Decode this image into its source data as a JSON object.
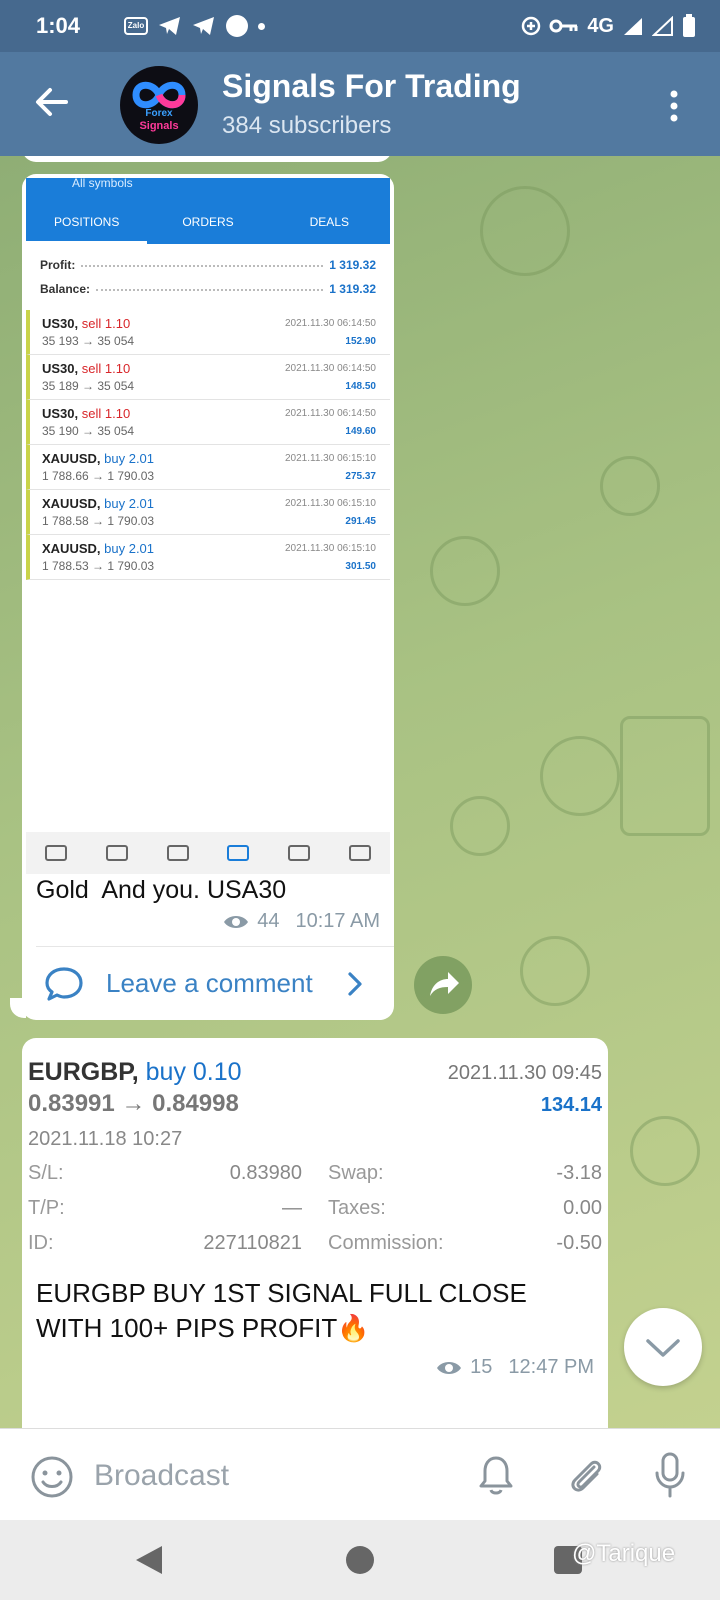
{
  "status": {
    "time": "1:04",
    "zalo": "Zalo",
    "network": "4G"
  },
  "header": {
    "back_icon": "arrow-left-icon",
    "avatar_line1": "Forex",
    "avatar_line2": "Signals",
    "title": "Signals For Trading",
    "subtitle": "384 subscribers"
  },
  "post1": {
    "screenshot": {
      "symbols_label": "All symbols",
      "tabs": [
        "POSITIONS",
        "ORDERS",
        "DEALS"
      ],
      "profit_label": "Profit:",
      "profit_value": "1 319.32",
      "balance_label": "Balance:",
      "balance_value": "1 319.32",
      "trades": [
        {
          "symbol": "US30,",
          "side": "sell 1.10",
          "prices": "35 193 → 35 054",
          "time": "2021.11.30 06:14:50",
          "profit": "152.90"
        },
        {
          "symbol": "US30,",
          "side": "sell 1.10",
          "prices": "35 189 → 35 054",
          "time": "2021.11.30 06:14:50",
          "profit": "148.50"
        },
        {
          "symbol": "US30,",
          "side": "sell 1.10",
          "prices": "35 190 → 35 054",
          "time": "2021.11.30 06:14:50",
          "profit": "149.60"
        },
        {
          "symbol": "XAUUSD,",
          "side": "buy 2.01",
          "prices": "1 788.66 → 1 790.03",
          "time": "2021.11.30 06:15:10",
          "profit": "275.37"
        },
        {
          "symbol": "XAUUSD,",
          "side": "buy 2.01",
          "prices": "1 788.58 → 1 790.03",
          "time": "2021.11.30 06:15:10",
          "profit": "291.45"
        },
        {
          "symbol": "XAUUSD,",
          "side": "buy 2.01",
          "prices": "1 788.53 → 1 790.03",
          "time": "2021.11.30 06:15:10",
          "profit": "301.50"
        }
      ]
    },
    "caption": "Gold  And you. USA30",
    "views": "44",
    "time": "10:17 AM",
    "comment_label": "Leave a comment"
  },
  "post2": {
    "symbol": "EURGBP,",
    "side": "buy 0.10",
    "close_date": "2021.11.30 09:45",
    "prices": "0.83991 → 0.84998",
    "profit": "134.14",
    "open_date": "2021.11.18 10:27",
    "rows": [
      {
        "l1": "S/L:",
        "v1": "0.83980",
        "l2": "Swap:",
        "v2": "-3.18"
      },
      {
        "l1": "T/P:",
        "v1": "—",
        "l2": "Taxes:",
        "v2": "0.00"
      },
      {
        "l1": "ID:",
        "v1": "227110821",
        "l2": "Commission:",
        "v2": "-0.50"
      }
    ],
    "caption": "EURGBP BUY 1ST SIGNAL FULL CLOSE WITH 100+ PIPS PROFIT🔥",
    "views": "15",
    "time": "12:47 PM"
  },
  "input": {
    "placeholder": "Broadcast"
  },
  "watermark": "@Tarique"
}
